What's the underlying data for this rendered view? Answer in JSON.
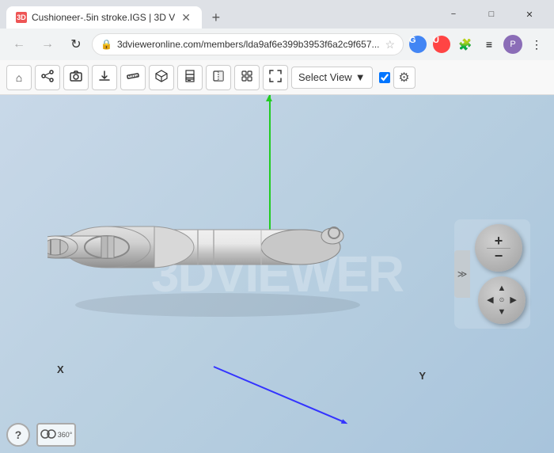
{
  "browser": {
    "tab": {
      "title": "Cushioneer-.5in stroke.IGS | 3D V",
      "icon_label": "3D"
    },
    "new_tab_label": "+",
    "window_controls": {
      "minimize": "−",
      "maximize": "□",
      "close": "✕"
    },
    "nav": {
      "back": "←",
      "forward": "→",
      "refresh": "↻",
      "address": "3dvieweronline.com/members/lda9af6e399b3953f6a2c9f657...",
      "star": "☆"
    },
    "extensions": {
      "g_label": "G",
      "u_label": "U",
      "user_label": "P"
    }
  },
  "toolbar": {
    "buttons": [
      {
        "name": "home",
        "icon": "⌂"
      },
      {
        "name": "share",
        "icon": "⬆"
      },
      {
        "name": "screenshot",
        "icon": "📷"
      },
      {
        "name": "download",
        "icon": "⬇"
      },
      {
        "name": "measure",
        "icon": "📏"
      },
      {
        "name": "view-cube",
        "icon": "⬡"
      },
      {
        "name": "print",
        "icon": "🖨"
      },
      {
        "name": "section",
        "icon": "◫"
      },
      {
        "name": "explode",
        "icon": "↗"
      }
    ],
    "select_view_label": "Select View",
    "select_view_arrow": "▼",
    "checkbox_checked": true,
    "gear_icon": "⚙"
  },
  "viewer": {
    "watermark": "3D VIEWER",
    "axis_x": "X",
    "axis_y": "Y",
    "nav_controls": {
      "collapse_icon": "≫",
      "plus": "+",
      "minus": "−",
      "arrows": {
        "up": "▲",
        "down": "▼",
        "left": "◀",
        "right": "▶"
      }
    }
  },
  "bottom_bar": {
    "help_label": "?",
    "vr_label": "360°"
  }
}
